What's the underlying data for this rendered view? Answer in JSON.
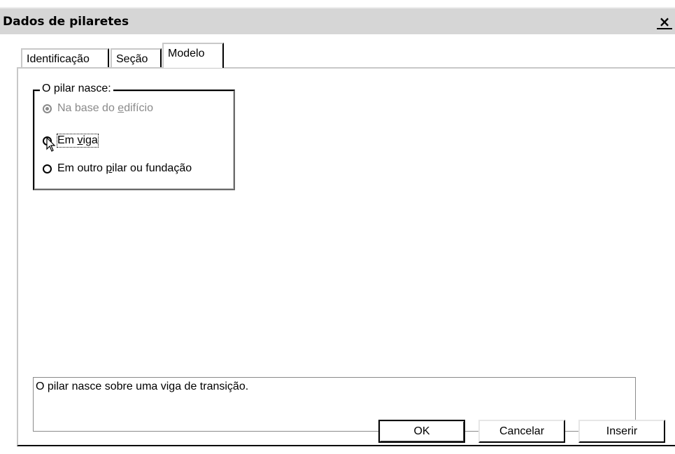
{
  "window": {
    "title": "Dados de pilaretes",
    "close_glyph": "×"
  },
  "tabs": [
    {
      "label": "Identificação"
    },
    {
      "label": "Seção"
    },
    {
      "label": "Modelo"
    }
  ],
  "group": {
    "legend": "O pilar nasce:",
    "options": [
      {
        "pre": "Na base do ",
        "ul": "e",
        "post": "difício",
        "state": "selected-disabled"
      },
      {
        "pre": "Em ",
        "ul": "v",
        "post": "iga",
        "state": "focused"
      },
      {
        "pre": "Em outro ",
        "ul": "p",
        "post": "ilar ou fundação",
        "state": "unselected"
      }
    ]
  },
  "description": "O pilar nasce sobre uma viga de transição.",
  "buttons": {
    "ok": "OK",
    "cancel": "Cancelar",
    "insert": "Inserir"
  },
  "icons": {
    "close": "close-icon",
    "cursor": "mouse-pointer-icon"
  }
}
